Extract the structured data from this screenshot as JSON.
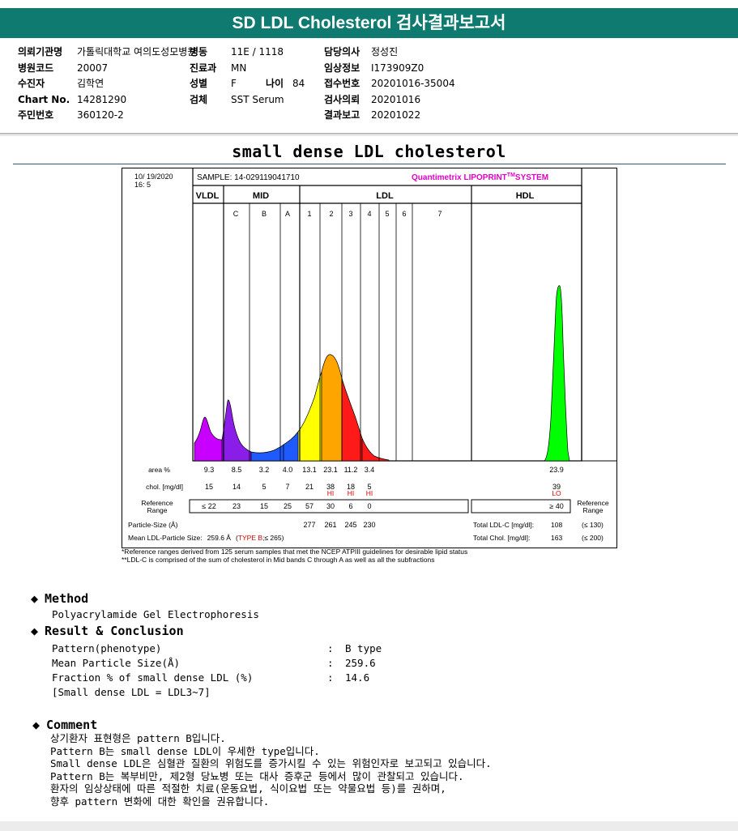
{
  "report": {
    "title": "SD LDL Cholesterol 검사결과보고서",
    "subtitle": "small dense LDL cholesterol"
  },
  "info": {
    "hospital_label": "의뢰기관명",
    "hospital_value": "가톨릭대학교 여의도성모병원",
    "ward_label": "병동",
    "ward_value": "11E / 1118",
    "doctor_label": "담당의사",
    "doctor_value": "정성진",
    "code_label": "병원코드",
    "code_value": "20007",
    "dept_label": "진료과",
    "dept_value": "MN",
    "clinical_label": "임상정보",
    "clinical_value": "I173909Z0",
    "patient_label": "수진자",
    "patient_value": "김학연",
    "sex_label": "성별",
    "sex_value": "F",
    "age_label": "나이",
    "age_value": "84",
    "receipt_label": "접수번호",
    "receipt_value": "20201016-35004",
    "chart_label": "Chart No.",
    "chart_value": "14281290",
    "specimen_label": "검체",
    "specimen_value": "SST Serum",
    "request_label": "검사의뢰",
    "request_value": "20201016",
    "id_label": "주민번호",
    "id_value": "360120-2",
    "result_label": "결과보고",
    "result_value": "20201022"
  },
  "chart_data": {
    "type": "area",
    "date": "10/ 19/2020",
    "time": "16: 5",
    "sample": "SAMPLE:   14-029119041710",
    "brand": "Quantimetrix LIPOPRINT",
    "brand_tm": "TM",
    "brand_suffix": "SYSTEM",
    "groups": [
      "VLDL",
      "MID",
      "LDL",
      "HDL"
    ],
    "bands": [
      "C",
      "B",
      "A",
      "1",
      "2",
      "3",
      "4",
      "5",
      "6",
      "7"
    ],
    "rows": {
      "area_label": "area %",
      "chol_label": "chol. [mg/dl]",
      "ref_label_1": "Reference",
      "ref_label_2": "Range",
      "ref_label_right_1": "Reference",
      "ref_label_right_2": "Range",
      "size_label": "Particle-Size (Å)",
      "mean_label": "Mean LDL-Particle Size:",
      "mean_value": "259.6 Å",
      "mean_type_open": "(",
      "mean_type": "TYPE B",
      "mean_type_close": ";≤ 265)"
    },
    "columns": [
      "VLDL",
      "C",
      "B",
      "A",
      "1",
      "2",
      "3",
      "4",
      "HDL"
    ],
    "area": [
      "9.3",
      "8.5",
      "3.2",
      "4.0",
      "13.1",
      "23.1",
      "11.2",
      "3.4",
      "23.9"
    ],
    "chol": [
      "15",
      "14",
      "5",
      "7",
      "21",
      "38",
      "18",
      "5",
      "39"
    ],
    "flags": [
      "",
      "",
      "",
      "",
      "",
      "HI",
      "HI",
      "HI",
      "LO"
    ],
    "reference": [
      "≤ 22",
      "23",
      "15",
      "25",
      "57",
      "30",
      "6",
      "0",
      "≥ 40"
    ],
    "particle_size": [
      "277",
      "261",
      "245",
      "230"
    ],
    "total_ldl_label": "Total LDL-C [mg/dl]:",
    "total_ldl_value": "108",
    "total_ldl_ref": "(≤ 130)",
    "total_chol_label": "Total Chol. [mg/dl]:",
    "total_chol_value": "163",
    "total_chol_ref": "(≤ 200)"
  },
  "footnotes": [
    "*Reference ranges derived from 125 serum samples that met the NCEP ATPIII guidelines for desirable lipid status",
    "**LDL-C is comprised of the sum of cholesterol in Mid bands C through A as well as all the subfractions"
  ],
  "method": {
    "heading": "Method",
    "text": "Polyacrylamide Gel Electrophoresis"
  },
  "result": {
    "heading": "Result & Conclusion",
    "rows": [
      {
        "label": "Pattern(phenotype)",
        "colon": ":",
        "value": "B type"
      },
      {
        "label": "Mean Particle Size(Å)",
        "colon": ":",
        "value": "259.6"
      },
      {
        "label": "Fraction % of small dense LDL (%)",
        "colon": ":",
        "value": "14.6"
      }
    ],
    "note": "[Small dense LDL = LDL3~7]"
  },
  "comment": {
    "heading": "Comment",
    "lines": [
      "상기환자 표현형은 pattern B입니다.",
      "Pattern B는 small dense LDL이 우세한 type입니다.",
      "Small dense LDL은 심혈관 질환의 위험도를 증가시킬 수 있는 위험인자로 보고되고 있습니다.",
      "Pattern B는 복부비만, 제2형 당뇨병 또는 대사 증후군 등에서 많이 관찰되고 있습니다.",
      "환자의 임상상태에 따른 적절한 치료(운동요법, 식이요법 또는 약물요법 등)를 권하며,",
      "향후 pattern 변화에 대한 확인을 권유합니다."
    ]
  },
  "colors": {
    "header": "#0f7b70",
    "vldl": "#c800ff",
    "mid_c": "#8a1ee8",
    "mid_b": "#1e5aff",
    "ldl1": "#ffff00",
    "ldl2": "#ffa500",
    "ldl3": "#ff1a1a",
    "hdl": "#00ff00",
    "flag": "#e00000",
    "brand": "#e000c8"
  }
}
